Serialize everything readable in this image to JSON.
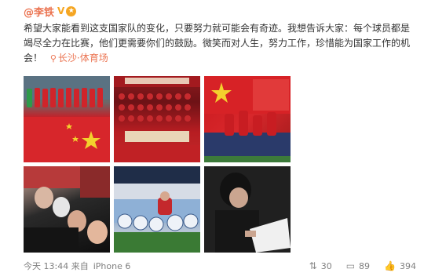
{
  "post": {
    "username": "@李铁",
    "verified_badge": "V",
    "medal_icon": "medal-icon",
    "text": "希望大家能看到这支国家队的变化，只要努力就可能会有奇迹。我想告诉大家：每个球员都是竭尽全力在比赛，他们更需要你们的鼓励。微笑而对人生，努力工作，珍惜能为国家工作的机会！",
    "location": "长沙·体育场"
  },
  "images": [
    {
      "name": "team-lineup-photo"
    },
    {
      "name": "team-group-photo"
    },
    {
      "name": "players-celebrating-photo"
    },
    {
      "name": "stadium-selfie-photo"
    },
    {
      "name": "ball-on-pitch-photo"
    },
    {
      "name": "coach-writing-photo"
    }
  ],
  "footer": {
    "time": "今天 13:44 来自",
    "device": "iPhone 6",
    "reposts": "30",
    "comments": "89",
    "likes": "394"
  },
  "colors": {
    "accent": "#eb7350",
    "badge": "#f5a623",
    "meta": "#808080"
  }
}
